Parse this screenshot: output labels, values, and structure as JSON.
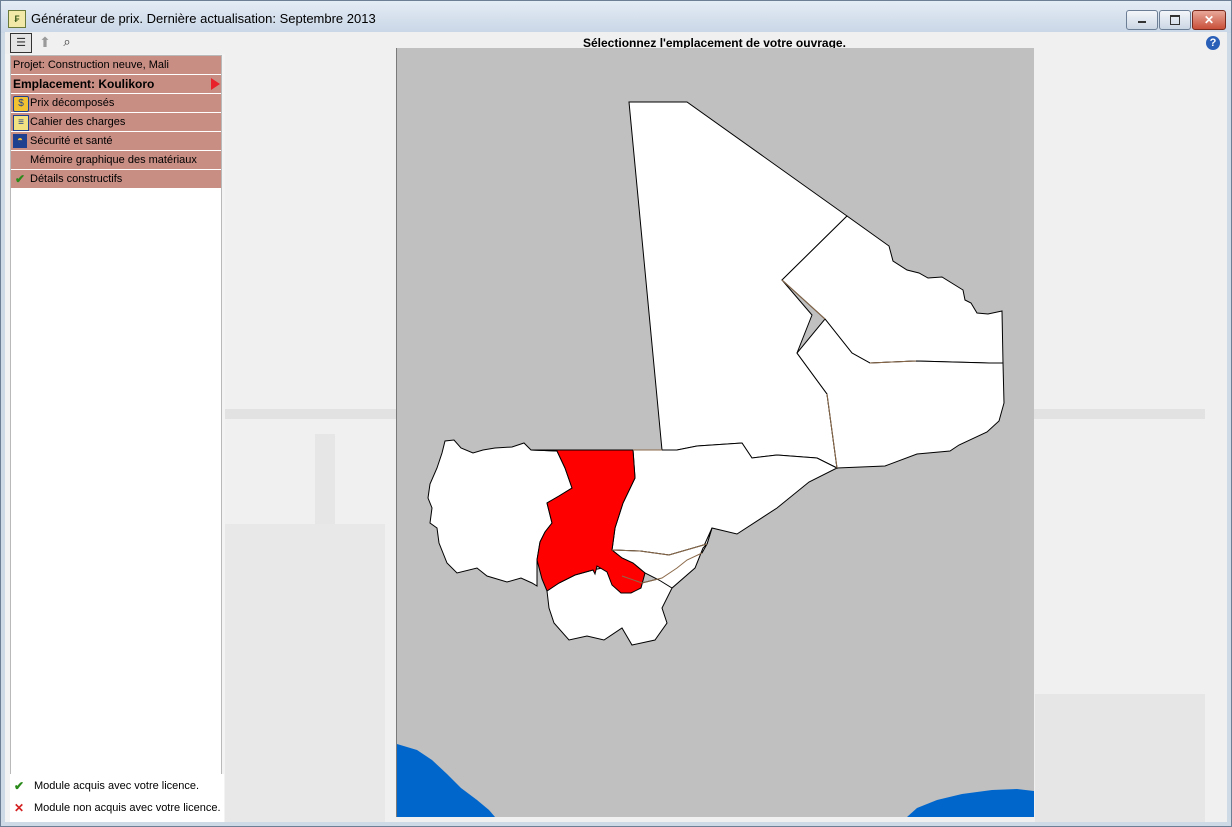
{
  "window": {
    "title": "Générateur de prix. Dernière actualisation: Septembre 2013",
    "app_icon": "price-generator-icon"
  },
  "toolbar": {
    "icons": [
      "report-icon",
      "up-arrow-icon",
      "binoculars-icon"
    ]
  },
  "header": {
    "text": "Sélectionnez l'emplacement de votre ouvrage.",
    "help_icon": "help-icon"
  },
  "sidebar": {
    "items": [
      {
        "label": "Projet: Construction neuve, Mali",
        "icon": null
      },
      {
        "label": "Emplacement: Koulikoro",
        "icon": "arrow-right-icon",
        "selected": true
      },
      {
        "label": "Prix décomposés",
        "icon": "price-breakdown-icon"
      },
      {
        "label": "Cahier des charges",
        "icon": "specifications-icon"
      },
      {
        "label": "Sécurité et santé",
        "icon": "safety-helmet-icon"
      },
      {
        "label": "Mémoire graphique des matériaux",
        "icon": null
      },
      {
        "label": "Détails constructifs",
        "icon": "check-icon"
      }
    ]
  },
  "legend": {
    "acquired": "Module acquis avec votre licence.",
    "not_acquired": "Module non acquis avec votre licence."
  },
  "map": {
    "selected_region": "Koulikoro",
    "colors": {
      "background": "#c0c0c0",
      "region": "#ffffff",
      "selected": "#ff0000",
      "sea": "#0066cc",
      "border": "#000000",
      "internal_border": "#8b6a4a"
    }
  },
  "colors": {
    "sidebar_item": "#c88e84",
    "accent_arrow": "#e8212b"
  }
}
